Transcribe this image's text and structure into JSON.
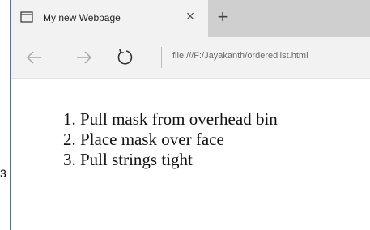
{
  "stray_text": "3",
  "browser": {
    "tab": {
      "title": "My new Webpage",
      "close_glyph": "×"
    },
    "new_tab_glyph": "+",
    "nav": {
      "back_icon": "arrow-left-icon",
      "forward_icon": "arrow-right-icon",
      "refresh_icon": "refresh-icon"
    },
    "address": {
      "url": "file:///F:/Jayakanth/orderedlist.html"
    }
  },
  "page": {
    "list_items": [
      "Pull mask from overhead bin",
      "Place mask over face",
      "Pull strings tight"
    ]
  }
}
